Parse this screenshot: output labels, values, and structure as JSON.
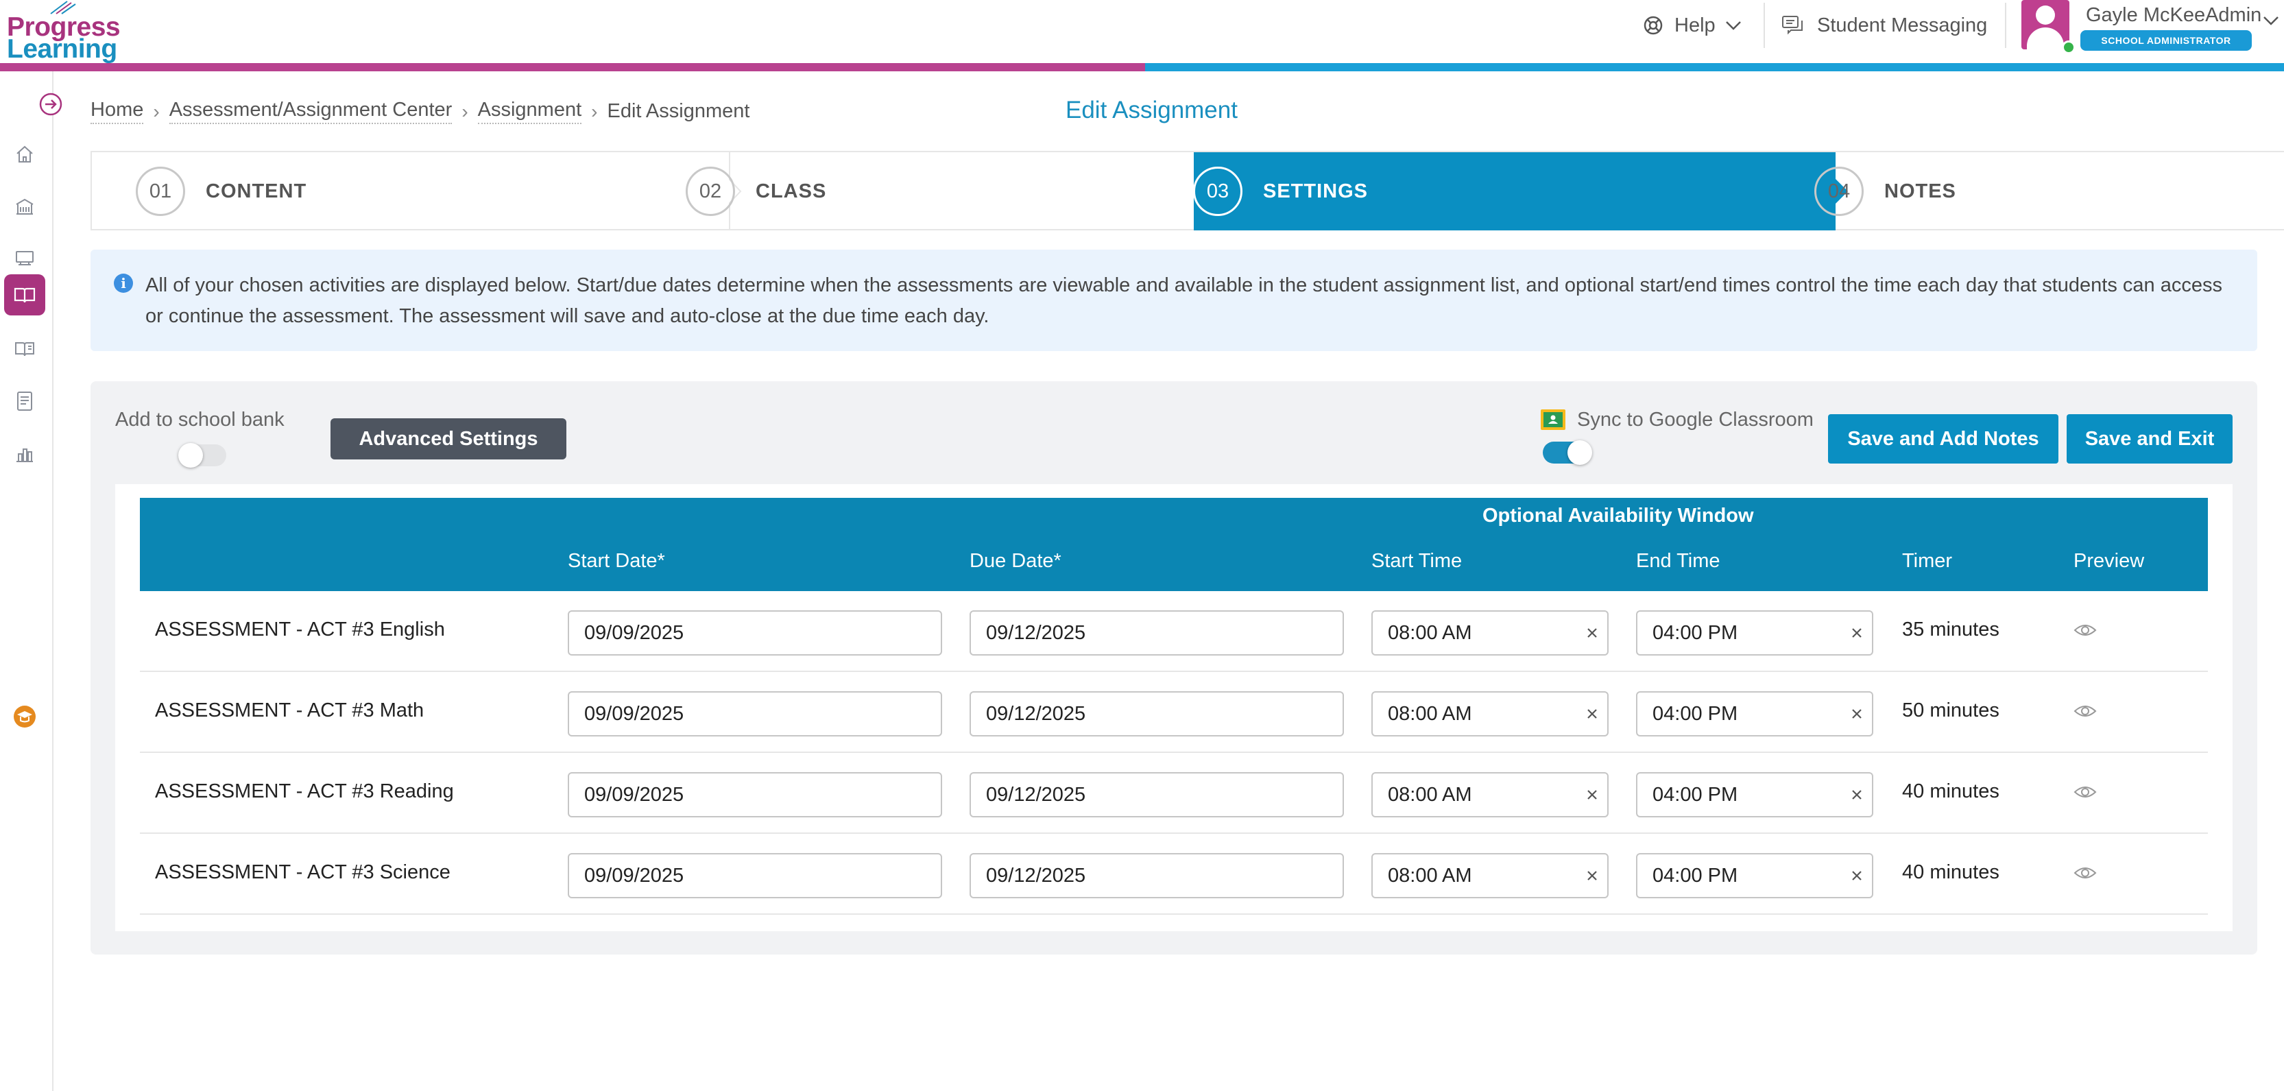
{
  "brand": {
    "line1": "Progress",
    "line2": "Learning",
    "color_magenta": "#a8337e",
    "color_blue": "#1a8fbf"
  },
  "header": {
    "help_label": "Help",
    "messaging_label": "Student Messaging",
    "user_name": "Gayle McKeeAdmin",
    "user_role": "SCHOOL ADMINISTRATOR",
    "status_color": "#35b34a"
  },
  "rail": {
    "items": [
      "home-icon",
      "school-icon",
      "classroom-icon",
      "book-open-icon",
      "book-icon",
      "report-icon",
      "chart-icon",
      "graduation-cap-icon"
    ],
    "active_item": "book-open-icon",
    "active_color": "#a8337e"
  },
  "breadcrumb": {
    "home": "Home",
    "center": "Assessment/Assignment Center",
    "assignment": "Assignment",
    "current": "Edit Assignment"
  },
  "page_title": "Edit Assignment",
  "steps": [
    {
      "num": "01",
      "label": "CONTENT"
    },
    {
      "num": "02",
      "label": "CLASS"
    },
    {
      "num": "03",
      "label": "SETTINGS",
      "active": true
    },
    {
      "num": "04",
      "label": "NOTES"
    }
  ],
  "info_text": "All of your chosen activities are displayed below. Start/due dates determine when the assessments are viewable and available in the student assignment list, and optional start/end times control the time each day that students can access or continue the assessment. The assessment will save and auto-close at the due time each day.",
  "settings": {
    "school_bank_label": "Add to school bank",
    "school_bank_on": false,
    "advanced_label": "Advanced Settings",
    "google_label": "Sync to Google Classroom",
    "google_on": true,
    "save_notes_label": "Save and Add Notes",
    "save_exit_label": "Save and Exit"
  },
  "table": {
    "group_header": "Optional Availability Window",
    "columns": {
      "start_date": "Start Date*",
      "due_date": "Due Date*",
      "start_time": "Start Time",
      "end_time": "End Time",
      "timer": "Timer",
      "preview": "Preview"
    },
    "rows": [
      {
        "name": "ASSESSMENT - ACT #3 English",
        "start_date": "09/09/2025",
        "due_date": "09/12/2025",
        "start_time": "08:00 AM",
        "end_time": "04:00 PM",
        "timer": "35 minutes"
      },
      {
        "name": "ASSESSMENT - ACT #3 Math",
        "start_date": "09/09/2025",
        "due_date": "09/12/2025",
        "start_time": "08:00 AM",
        "end_time": "04:00 PM",
        "timer": "50 minutes"
      },
      {
        "name": "ASSESSMENT - ACT #3 Reading",
        "start_date": "09/09/2025",
        "due_date": "09/12/2025",
        "start_time": "08:00 AM",
        "end_time": "04:00 PM",
        "timer": "40 minutes"
      },
      {
        "name": "ASSESSMENT - ACT #3 Science",
        "start_date": "09/09/2025",
        "due_date": "09/12/2025",
        "start_time": "08:00 AM",
        "end_time": "04:00 PM",
        "timer": "40 minutes"
      }
    ]
  },
  "colors": {
    "accent": "#0a8fc2",
    "table_header": "#0b86b3",
    "dark_button": "#4e5560",
    "banner_bg": "#eaf3fd"
  }
}
